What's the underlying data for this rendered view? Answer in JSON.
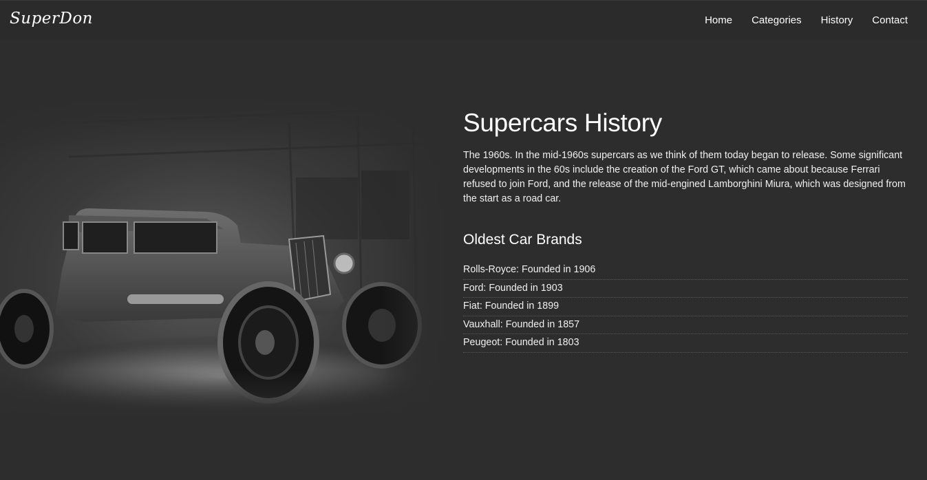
{
  "nav": {
    "brand": "SuperDon",
    "links": [
      "Home",
      "Categories",
      "History",
      "Contact"
    ]
  },
  "main": {
    "title": "Supercars History",
    "paragraph": "The 1960s. In the mid-1960s supercars as we think of them today began to release. Some significant developments in the 60s include the creation of the Ford GT, which came about because Ferrari refused to join Ford, and the release of the mid-engined Lamborghini Miura, which was designed from the start as a road car.",
    "subtitle": "Oldest Car Brands",
    "brands": [
      "Rolls-Royce: Founded in 1906",
      "Ford: Founded in 1903",
      "Fiat: Founded in 1899",
      "Vauxhall: Founded in 1857",
      "Peugeot: Founded in 1803"
    ]
  },
  "colors": {
    "background": "#2d2d2d",
    "navbar": "#2b2b2b",
    "text": "#f0f0f0"
  }
}
